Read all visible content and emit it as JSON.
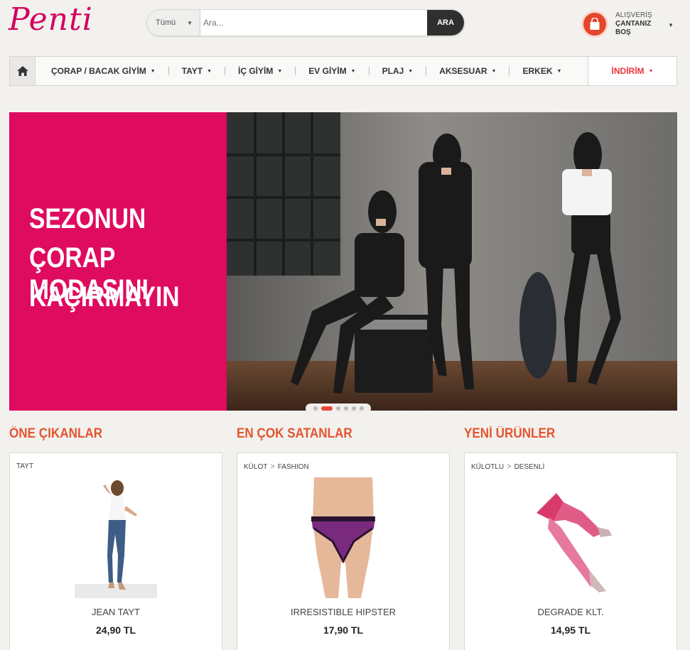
{
  "brand": {
    "logo": "Penti"
  },
  "search": {
    "category": "Tümü",
    "placeholder": "Ara...",
    "button": "ARA"
  },
  "cart": {
    "line1": "ALIŞVERİŞ",
    "line2": "ÇANTANIZ",
    "line3": "BOŞ"
  },
  "nav": {
    "items": [
      {
        "label": "ÇORAP / BACAK GİYİM"
      },
      {
        "label": "TAYT"
      },
      {
        "label": "İÇ GİYİM"
      },
      {
        "label": "EV GİYİM"
      },
      {
        "label": "PLAJ"
      },
      {
        "label": "AKSESUAR"
      },
      {
        "label": "ERKEK"
      }
    ],
    "sale": "İNDİRİM"
  },
  "banner": {
    "lines": [
      "SEZONUN",
      "ÇORAP MODASINI",
      "KAÇIRMAYIN"
    ],
    "slides": 6,
    "active_slide": 2,
    "colors": {
      "pink": "#df0b5e"
    }
  },
  "sections": [
    {
      "title": "ÖNE ÇIKANLAR",
      "crumbs": [
        "TAYT"
      ],
      "product": {
        "name": "JEAN TAYT",
        "price": "24,90 TL"
      }
    },
    {
      "title": "EN ÇOK SATANLAR",
      "crumbs": [
        "KÜLOT",
        "FASHION"
      ],
      "product": {
        "name": "IRRESISTIBLE HIPSTER",
        "price": "17,90 TL"
      }
    },
    {
      "title": "YENİ ÜRÜNLER",
      "crumbs": [
        "KÜLOTLU",
        "DESENLİ"
      ],
      "product": {
        "name": "DEGRADE KLT.",
        "price": "14,95 TL"
      }
    }
  ],
  "colors": {
    "accent": "#e4552f",
    "sale": "#e8353c",
    "brand": "#d4005f"
  }
}
